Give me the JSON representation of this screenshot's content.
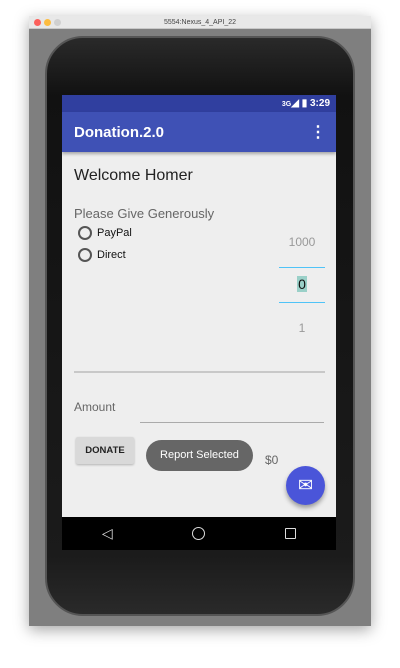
{
  "window": {
    "title": "5554:Nexus_4_API_22"
  },
  "status": {
    "network": "3G",
    "time": "3:29"
  },
  "appbar": {
    "title": "Donation.2.0",
    "menu_icon": "more-vert-icon"
  },
  "main": {
    "welcome": "Welcome Homer",
    "prompt": "Please Give Generously",
    "payment_options": [
      {
        "label": "PayPal",
        "selected": false
      },
      {
        "label": "Direct",
        "selected": false
      }
    ],
    "picker": {
      "above": "1000",
      "current": "0",
      "below": "1"
    },
    "amount_label": "Amount",
    "amount_value": "",
    "donate_label": "DONATE",
    "total": "$0",
    "toast": "Report Selected",
    "fab_icon": "email-icon"
  },
  "colors": {
    "primary": "#3f51b5",
    "primary_dark": "#303f9f",
    "accent": "#4a55d9",
    "picker_line": "#4fc3f7"
  }
}
